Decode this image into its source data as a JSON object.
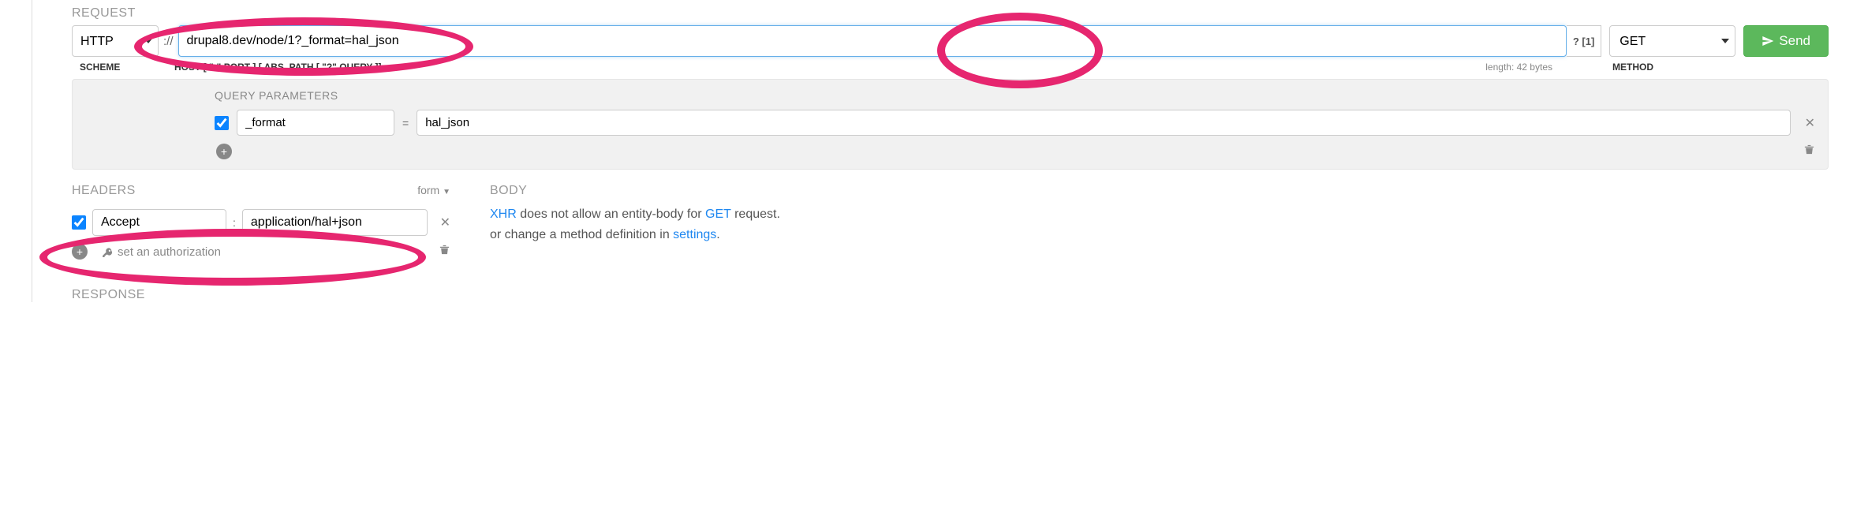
{
  "sections": {
    "request": "REQUEST",
    "headers": "HEADERS",
    "body": "BODY",
    "response": "RESPONSE",
    "query": "QUERY PARAMETERS"
  },
  "scheme": {
    "value": "HTTP",
    "label": "SCHEME"
  },
  "separator": "://",
  "url": {
    "value": "drupal8.dev/node/1?_format=hal_json",
    "label": "HOST [ \":\" PORT ] [ ABS_PATH [ \"?\" QUERY ]]"
  },
  "length_text": "length: 42 bytes",
  "hint_text": "? [1]",
  "method": {
    "value": "GET",
    "label": "METHOD"
  },
  "send_label": "Send",
  "query_params": [
    {
      "enabled": true,
      "key": "_format",
      "value": "hal_json"
    }
  ],
  "headers_form_label": "form",
  "headers": [
    {
      "enabled": true,
      "key": "Accept",
      "value": "application/hal+json"
    }
  ],
  "auth_link": "set an authorization",
  "body_msg": {
    "prefix": "XHR",
    "mid1": " does not allow an entity-body for ",
    "method_link": "GET",
    "suffix1": " request.",
    "line2a": "or change a method definition in ",
    "settings_link": "settings",
    "line2b": "."
  }
}
